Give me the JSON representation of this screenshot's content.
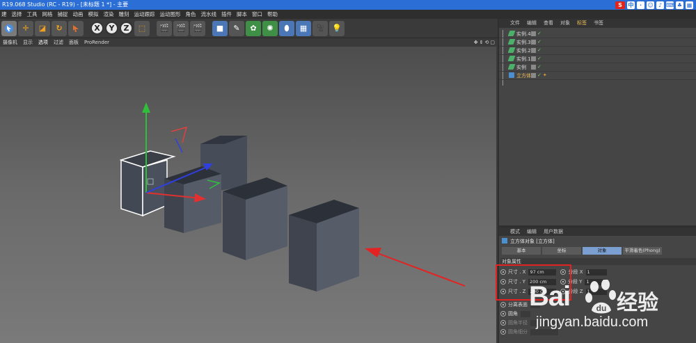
{
  "window": {
    "title": "R19.068 Studio (RC - R19) - [未标题 1 *] - 主要",
    "tray_icons": [
      "sogou-icon",
      "chinese-input-icon",
      "punctuation-icon",
      "emoji-icon",
      "microphone-icon",
      "keyboard-icon",
      "skin-icon",
      "grid-icon"
    ],
    "tray_labels": [
      "S",
      "中",
      "·",
      "☺",
      "♪",
      "⌨",
      "♣",
      "▦"
    ]
  },
  "menu": [
    "建",
    "选择",
    "工具",
    "网格",
    "捕捉",
    "动画",
    "模拟",
    "渲染",
    "雕刻",
    "运动跟踪",
    "运动图形",
    "角色",
    "流水线",
    "插件",
    "脚本",
    "窗口",
    "帮助"
  ],
  "toolbar": {
    "axis_labels": [
      "X",
      "Y",
      "Z"
    ]
  },
  "viewport": {
    "menu": [
      "摄像机",
      "显示",
      "选项",
      "过滤",
      "面板",
      "ProRender"
    ],
    "active_menu_index": 2
  },
  "object_manager": {
    "tabs": [
      "文件",
      "编辑",
      "查看",
      "对象",
      "标签",
      "书签"
    ],
    "active_tab_index": 4,
    "objects": [
      {
        "name": "实例.4",
        "type": "instance",
        "selected": false
      },
      {
        "name": "实例.3",
        "type": "instance",
        "selected": false
      },
      {
        "name": "实例.2",
        "type": "instance",
        "selected": false
      },
      {
        "name": "实例.1",
        "type": "instance",
        "selected": false
      },
      {
        "name": "实例",
        "type": "instance",
        "selected": false
      },
      {
        "name": "立方体",
        "type": "cube",
        "selected": true
      }
    ]
  },
  "attributes": {
    "tabs": [
      "模式",
      "编辑",
      "用户数据"
    ],
    "title": "立方体对象 [立方体]",
    "subtabs": [
      "基本",
      "坐标",
      "对象",
      "平滑着色(Phong)"
    ],
    "active_subtab_index": 2,
    "section": "对象属性",
    "size": [
      {
        "label": "尺寸 . X",
        "value": "97 cm"
      },
      {
        "label": "尺寸 . Y",
        "value": "200 cm"
      },
      {
        "label": "尺寸 . Z",
        "value": "200 cm"
      }
    ],
    "segments": [
      {
        "label": "分段 X",
        "value": "1"
      },
      {
        "label": "分段 Y",
        "value": "1"
      },
      {
        "label": "分段 Z",
        "value": "1"
      }
    ],
    "options": [
      {
        "label": "分离表面",
        "value": ""
      },
      {
        "label": "圆角",
        "value": ""
      },
      {
        "label": "圆角半径",
        "value": ""
      },
      {
        "label": "圆角细分",
        "value": ""
      }
    ]
  },
  "watermark": {
    "brand": "Bai",
    "suffix": "经验",
    "url": "jingyan.baidu.com"
  },
  "colors": {
    "titlebar": "#2b6fd6",
    "selection": "#f1c05a",
    "annotation": "#e52222",
    "axis_x": "#e23030",
    "axis_y": "#2fbf3a",
    "axis_z": "#2f3fe0"
  }
}
